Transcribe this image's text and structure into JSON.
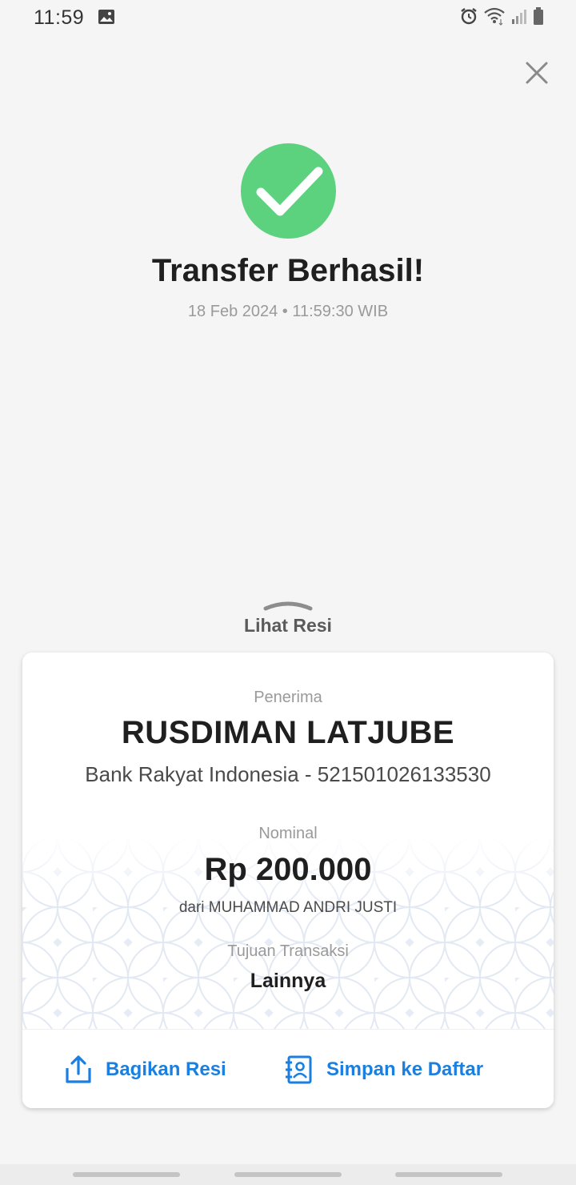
{
  "status_bar": {
    "time": "11:59",
    "icons": [
      "gallery-icon",
      "alarm-icon",
      "wifi-icon",
      "signal-icon",
      "battery-icon"
    ]
  },
  "header": {
    "close_icon": "close-icon"
  },
  "result": {
    "icon": "check-circle-icon",
    "title": "Transfer Berhasil!",
    "datetime": "18 Feb 2024 • 11:59:30 WIB"
  },
  "receipt_toggle": {
    "label": "Lihat Resi",
    "icon": "chevron-up-icon"
  },
  "receipt": {
    "recipient_label": "Penerima",
    "recipient_name": "RUSDIMAN LATJUBE",
    "bank_account": "Bank Rakyat Indonesia - 521501026133530",
    "amount_label": "Nominal",
    "amount": "Rp 200.000",
    "sender": "dari MUHAMMAD ANDRI JUSTI",
    "purpose_label": "Tujuan Transaksi",
    "purpose": "Lainnya"
  },
  "actions": {
    "share_label": "Bagikan Resi",
    "save_label": "Simpan ke Daftar"
  },
  "colors": {
    "success": "#5cd27e",
    "accent": "#1a7fe0",
    "background": "#f5f5f5"
  }
}
